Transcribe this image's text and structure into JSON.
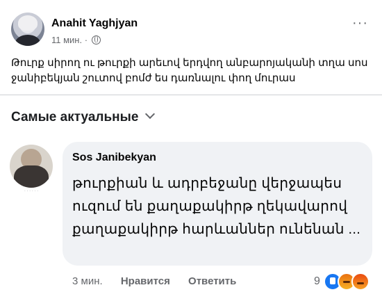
{
  "post": {
    "author": "Anahit Yaghjyan",
    "time": "11 мин. ·",
    "text": "Թուրք սիրող ու թուրքի արեւով երդվող անբարոյականի տղա սոս ջանիբեկյան շուտով բոմժ ես դառնալու փող մուրաս"
  },
  "comments_section": {
    "sort_label": "Самые актуальные"
  },
  "comment": {
    "author": "Sos Janibekyan",
    "text": "թուրքիան և  ադրբեջանը վերջապես ուզում են քաղաքակիրթ ղեկավարով քաղաքակիրթ հարևաններ ունենան ...",
    "time": "3 мин.",
    "like_label": "Нравится",
    "reply_label": "Ответить",
    "reaction_count": "9",
    "reactions": [
      "like-icon",
      "angry-icon",
      "angry-icon"
    ]
  }
}
